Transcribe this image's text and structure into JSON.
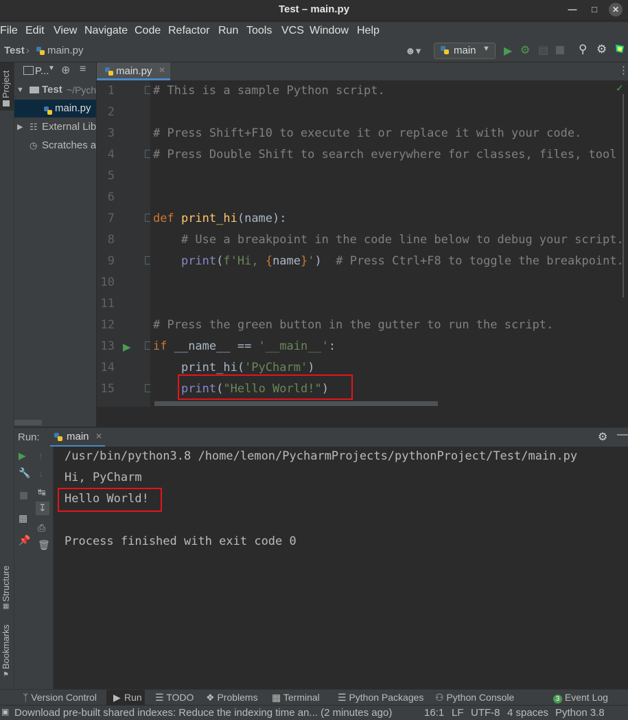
{
  "window": {
    "title": "Test – main.py"
  },
  "menu": [
    "File",
    "Edit",
    "View",
    "Navigate",
    "Code",
    "Refactor",
    "Run",
    "Tools",
    "VCS",
    "Window",
    "Help"
  ],
  "navbar": {
    "project": "Test",
    "file": "main.py",
    "branch": "main"
  },
  "project_panel": {
    "title": "P...",
    "items": [
      {
        "label": "Test",
        "suffix": "~/Pych"
      },
      {
        "label": "main.py"
      },
      {
        "label": "External Lib"
      },
      {
        "label": "Scratches a"
      }
    ]
  },
  "editor": {
    "tab": "main.py",
    "line_numbers": [
      "1",
      "2",
      "3",
      "4",
      "5",
      "6",
      "7",
      "8",
      "9",
      "10",
      "11",
      "12",
      "13",
      "14",
      "15"
    ]
  },
  "run_panel": {
    "label": "Run:",
    "tab": "main",
    "output": [
      "/usr/bin/python3.8 /home/lemon/PycharmProjects/pythonProject/Test/main.py",
      "Hi, PyCharm",
      "Hello World!",
      "",
      "Process finished with exit code 0"
    ]
  },
  "left_stripe": {
    "project": "Project",
    "structure": "Structure",
    "bookmarks": "Bookmarks"
  },
  "tool_windows": [
    {
      "label": "Version Control",
      "icon": "branch-icon"
    },
    {
      "label": "Run",
      "icon": "play-icon"
    },
    {
      "label": "TODO",
      "icon": "list-icon"
    },
    {
      "label": "Problems",
      "icon": "info-icon"
    },
    {
      "label": "Terminal",
      "icon": "terminal-icon"
    },
    {
      "label": "Python Packages",
      "icon": "layers-icon"
    },
    {
      "label": "Python Console",
      "icon": "python-icon"
    },
    {
      "label": "Event Log",
      "icon": "event-log-icon",
      "badge": "3"
    }
  ],
  "status_bar": {
    "message": "Download pre-built shared indexes: Reduce the indexing time an... (2 minutes ago)",
    "position": "16:1",
    "line_sep": "LF",
    "encoding": "UTF-8",
    "indent": "4 spaces",
    "interpreter": "Python 3.8"
  },
  "colors": {
    "highlight": "#e4151b",
    "run_green": "#499c54"
  }
}
